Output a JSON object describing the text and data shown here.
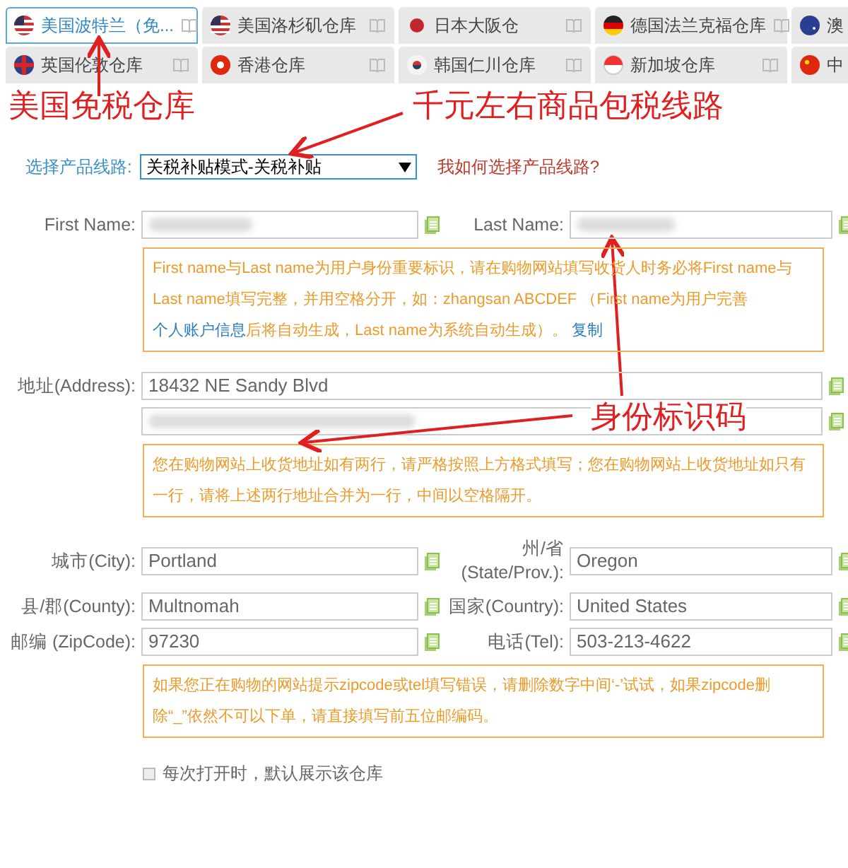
{
  "tab_rows": [
    [
      {
        "label": "美国波特兰（免...",
        "selected": true
      },
      {
        "label": "美国洛杉矶仓库",
        "selected": false
      },
      {
        "label": "日本大阪仓",
        "selected": false
      },
      {
        "label": "德国法兰克福仓库",
        "selected": false
      },
      {
        "label": "澳",
        "selected": false
      }
    ],
    [
      {
        "label": "英国伦敦仓库",
        "selected": false
      },
      {
        "label": "香港仓库",
        "selected": false
      },
      {
        "label": "韩国仁川仓库",
        "selected": false
      },
      {
        "label": "新加坡仓库",
        "selected": false
      },
      {
        "label": "中",
        "selected": false
      }
    ]
  ],
  "annotations": [
    "美国免税仓库",
    "千元左右商品包税线路",
    "身份标识码"
  ],
  "product_line": {
    "label": "选择产品线路:",
    "value": "关税补贴模式-关税补贴",
    "help_link": "我如何选择产品线路?"
  },
  "form": [
    {
      "kind": "pair",
      "fields": [
        {
          "label": "First Name:",
          "redacted": true
        },
        {
          "label": "Last Name:",
          "redacted": true
        }
      ]
    },
    {
      "kind": "notice",
      "parts": [
        {
          "kind": "text",
          "text": "First name与Last name为用户身份重要标识，请在购物网站填写收货人时务必将First name与Last name填写完整，并用空格分开，如：zhangsan ABCDEF （First name为用户完善"
        },
        {
          "kind": "link",
          "text": "个人账户信息"
        },
        {
          "kind": "text",
          "text": "后将自动生成，Last name为系统自动生成）。 "
        },
        {
          "kind": "link",
          "text": "复制"
        }
      ]
    },
    {
      "kind": "full",
      "label": "地址(Address):",
      "value": "18432 NE Sandy Blvd"
    },
    {
      "kind": "full",
      "redacted": true
    },
    {
      "kind": "notice",
      "parts": [
        {
          "kind": "text",
          "text": "您在购物网站上收货地址如有两行，请严格按照上方格式填写；您在购物网站上收货地址如只有一行，请将上述两行地址合并为一行，中间以空格隔开。"
        }
      ]
    },
    {
      "kind": "pair",
      "fields": [
        {
          "label": "城市(City):",
          "value": "Portland"
        },
        {
          "label": "州/省(State/Prov.):",
          "value": "Oregon"
        }
      ]
    },
    {
      "kind": "pair",
      "fields": [
        {
          "label": "县/郡(County):",
          "value": "Multnomah"
        },
        {
          "label": "国家(Country):",
          "value": "United States"
        }
      ]
    },
    {
      "kind": "pair",
      "fields": [
        {
          "label": "邮编 (ZipCode):",
          "value": "97230"
        },
        {
          "label": "电话(Tel):",
          "value": "503-213-4622"
        }
      ]
    },
    {
      "kind": "notice",
      "parts": [
        {
          "kind": "text",
          "text": "如果您正在购物的网站提示zipcode或tel填写错误，请删除数字中间‘-’试试，如果zipcode删除“_”依然不可以下单，请直接填写前五位邮编码。"
        }
      ]
    }
  ],
  "default_warehouse": {
    "label": "每次打开时，默认展示该仓库",
    "checked": false
  }
}
